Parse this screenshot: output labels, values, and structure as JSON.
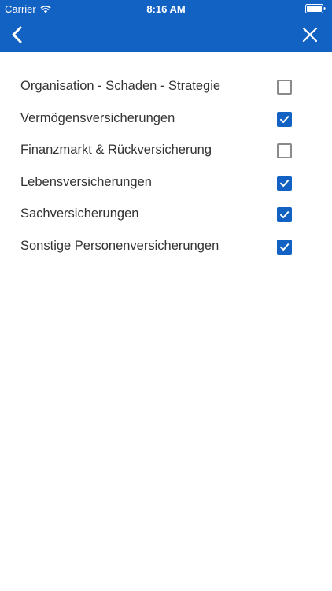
{
  "status_bar": {
    "carrier": "Carrier",
    "time": "8:16 AM"
  },
  "nav_bar": {
    "back_icon": "chevron-left-icon",
    "close_icon": "close-icon",
    "color": "#1262c4"
  },
  "categories": [
    {
      "label": "Organisation - Schaden - Strategie",
      "checked": false
    },
    {
      "label": "Vermögensversicherungen",
      "checked": true
    },
    {
      "label": "Finanzmarkt & Rückversicherung",
      "checked": false
    },
    {
      "label": "Lebensversicherungen",
      "checked": true
    },
    {
      "label": "Sachversicherungen",
      "checked": true
    },
    {
      "label": "Sonstige Personenversicherungen",
      "checked": true
    }
  ]
}
